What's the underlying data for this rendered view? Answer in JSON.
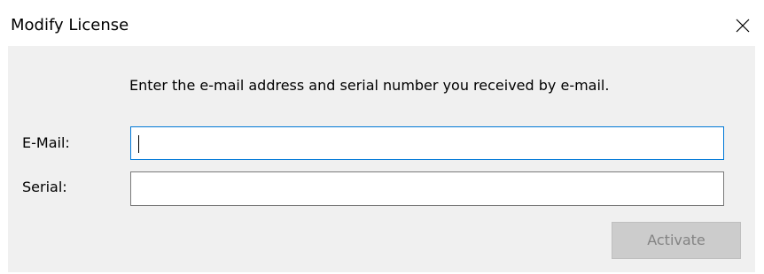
{
  "window": {
    "title": "Modify License",
    "close_icon": "close-icon"
  },
  "form": {
    "instruction": "Enter the e-mail address and serial number you received by e-mail.",
    "email_label": "E-Mail:",
    "email_value": "",
    "serial_label": "Serial:",
    "serial_value": "",
    "activate_label": "Activate",
    "activate_enabled": false
  },
  "colors": {
    "focus_border": "#0078d7",
    "dialog_background": "#f0f0f0",
    "disabled_button": "#cccccc"
  }
}
